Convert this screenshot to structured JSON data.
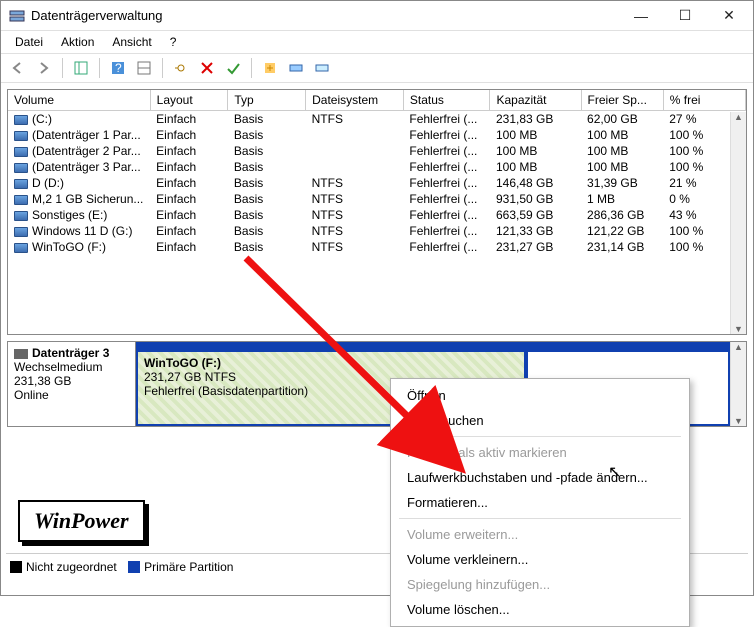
{
  "titlebar": {
    "title": "Datenträgerverwaltung"
  },
  "menu": {
    "file": "Datei",
    "action": "Aktion",
    "view": "Ansicht",
    "help": "?"
  },
  "columns": [
    "Volume",
    "Layout",
    "Typ",
    "Dateisystem",
    "Status",
    "Kapazität",
    "Freier Sp...",
    "% frei"
  ],
  "volumes": [
    {
      "name": "(C:)",
      "layout": "Einfach",
      "typ": "Basis",
      "fs": "NTFS",
      "status": "Fehlerfrei (...",
      "cap": "231,83 GB",
      "free": "62,00 GB",
      "pct": "27 %"
    },
    {
      "name": "(Datenträger 1 Par...",
      "layout": "Einfach",
      "typ": "Basis",
      "fs": "",
      "status": "Fehlerfrei (...",
      "cap": "100 MB",
      "free": "100 MB",
      "pct": "100 %"
    },
    {
      "name": "(Datenträger 2 Par...",
      "layout": "Einfach",
      "typ": "Basis",
      "fs": "",
      "status": "Fehlerfrei (...",
      "cap": "100 MB",
      "free": "100 MB",
      "pct": "100 %"
    },
    {
      "name": "(Datenträger 3 Par...",
      "layout": "Einfach",
      "typ": "Basis",
      "fs": "",
      "status": "Fehlerfrei (...",
      "cap": "100 MB",
      "free": "100 MB",
      "pct": "100 %"
    },
    {
      "name": "D (D:)",
      "layout": "Einfach",
      "typ": "Basis",
      "fs": "NTFS",
      "status": "Fehlerfrei (...",
      "cap": "146,48 GB",
      "free": "31,39 GB",
      "pct": "21 %"
    },
    {
      "name": "M,2 1 GB Sicherun...",
      "layout": "Einfach",
      "typ": "Basis",
      "fs": "NTFS",
      "status": "Fehlerfrei (...",
      "cap": "931,50 GB",
      "free": "1 MB",
      "pct": "0 %"
    },
    {
      "name": "Sonstiges (E:)",
      "layout": "Einfach",
      "typ": "Basis",
      "fs": "NTFS",
      "status": "Fehlerfrei (...",
      "cap": "663,59 GB",
      "free": "286,36 GB",
      "pct": "43 %"
    },
    {
      "name": "Windows 11 D (G:)",
      "layout": "Einfach",
      "typ": "Basis",
      "fs": "NTFS",
      "status": "Fehlerfrei (...",
      "cap": "121,33 GB",
      "free": "121,22 GB",
      "pct": "100 %"
    },
    {
      "name": "WinToGO (F:)",
      "layout": "Einfach",
      "typ": "Basis",
      "fs": "NTFS",
      "status": "Fehlerfrei (...",
      "cap": "231,27 GB",
      "free": "231,14 GB",
      "pct": "100 %"
    }
  ],
  "disk": {
    "header_title": "Datenträger 3",
    "header_type": "Wechselmedium",
    "header_size": "231,38 GB",
    "header_state": "Online",
    "vol_name": "WinToGO  (F:)",
    "vol_size": "231,27 GB NTFS",
    "vol_status": "Fehlerfrei (Basisdatenpartition)"
  },
  "legend": {
    "unalloc": "Nicht zugeordnet",
    "primary": "Primäre Partition"
  },
  "logo": "WinPower",
  "ctx": {
    "open": "Öffnen",
    "browse": "Durchsuchen",
    "active": "Partition als aktiv markieren",
    "drive": "Laufwerkbuchstaben und ‑pfade ändern...",
    "format": "Formatieren...",
    "extend": "Volume erweitern...",
    "shrink": "Volume verkleinern...",
    "mirror": "Spiegelung hinzufügen...",
    "delete": "Volume löschen..."
  }
}
